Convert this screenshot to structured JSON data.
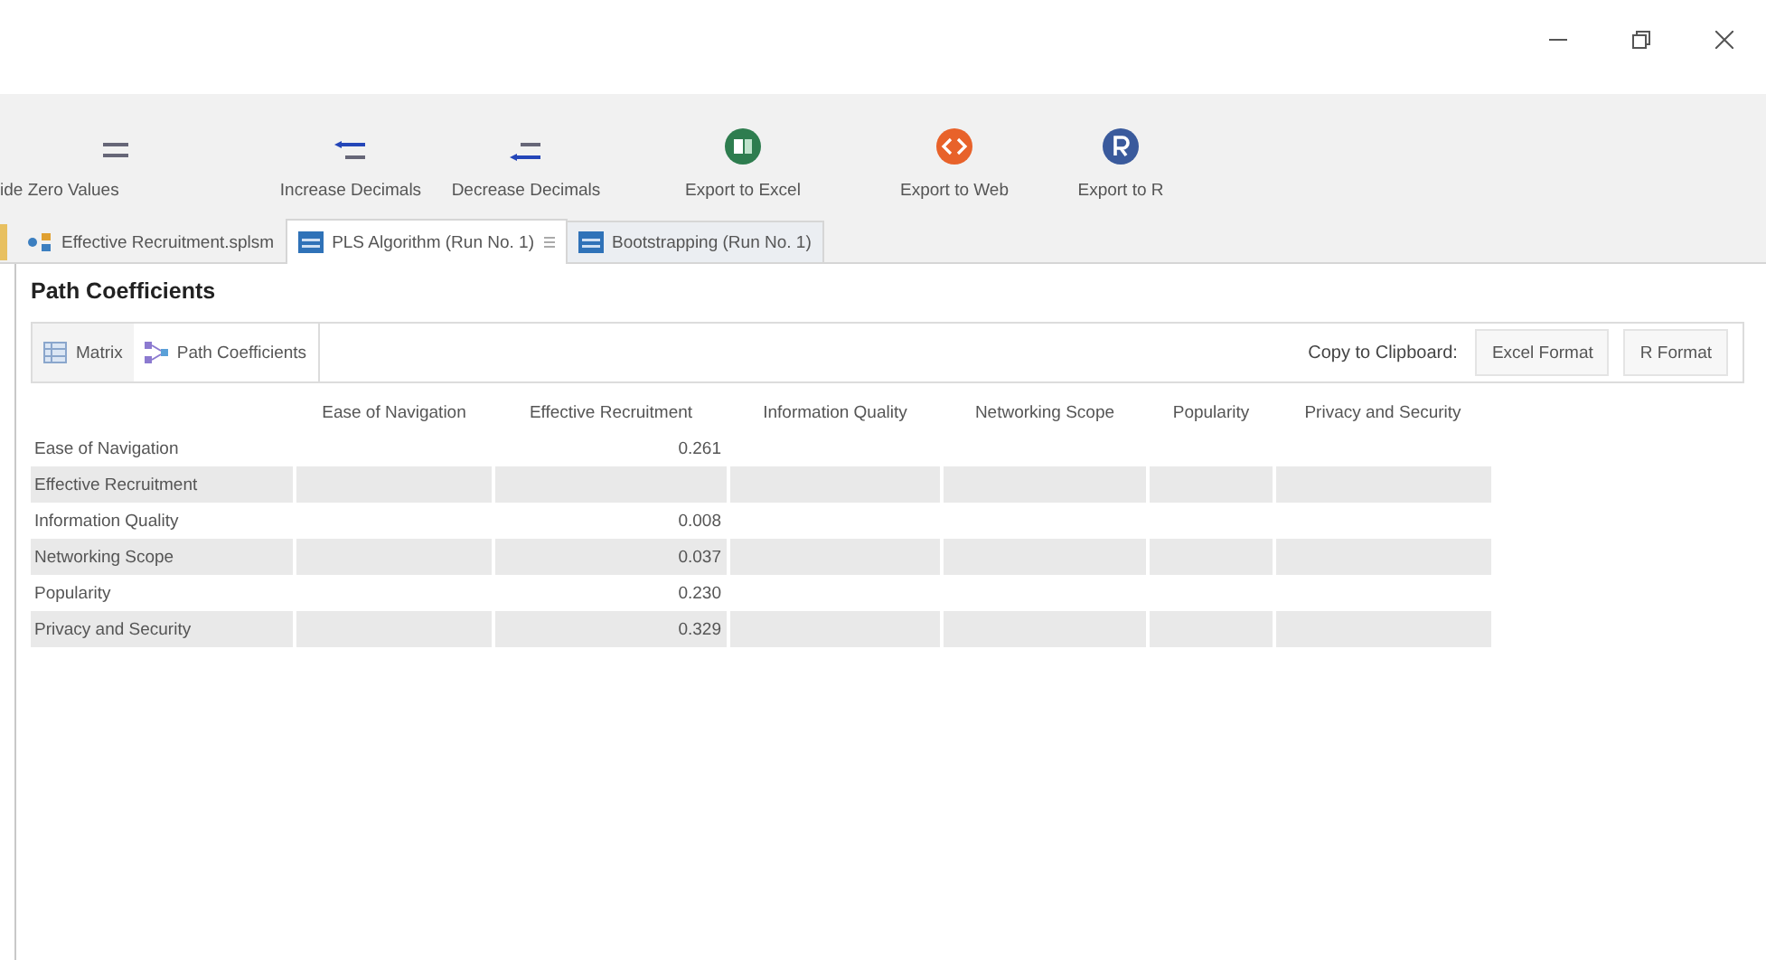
{
  "toolbar": [
    {
      "kind": "zero",
      "label": "ide Zero Values"
    },
    {
      "kind": "increase",
      "label": "Increase Decimals"
    },
    {
      "kind": "decrease",
      "label": "Decrease Decimals"
    },
    {
      "kind": "excel",
      "label": "Export to Excel"
    },
    {
      "kind": "web",
      "label": "Export to Web"
    },
    {
      "kind": "r",
      "label": "Export to R"
    }
  ],
  "tabs": [
    {
      "kind": "model",
      "label": "Effective Recruitment.splsm",
      "selected": false
    },
    {
      "kind": "report",
      "label": "PLS Algorithm (Run No. 1)",
      "selected": true
    },
    {
      "kind": "report",
      "label": "Bootstrapping (Run No. 1)",
      "selected": false
    }
  ],
  "section_title": "Path Coefficients",
  "view_tabs": [
    {
      "kind": "matrix",
      "label": "Matrix",
      "selected": false
    },
    {
      "kind": "path",
      "label": "Path Coefficients",
      "selected": true
    }
  ],
  "clipboard": {
    "label": "Copy to Clipboard:",
    "buttons": [
      "Excel Format",
      "R Format"
    ]
  },
  "table": {
    "columns": [
      "Ease of Navigation",
      "Effective Recruitment",
      "Information Quality",
      "Networking Scope",
      "Popularity",
      "Privacy and Security"
    ],
    "rows": [
      {
        "label": "Ease of Navigation",
        "cells": [
          null,
          "0.261",
          null,
          null,
          null,
          null
        ]
      },
      {
        "label": "Effective Recruitment",
        "cells": [
          null,
          null,
          null,
          null,
          null,
          null
        ]
      },
      {
        "label": "Information Quality",
        "cells": [
          null,
          "0.008",
          null,
          null,
          null,
          null
        ]
      },
      {
        "label": "Networking Scope",
        "cells": [
          null,
          "0.037",
          null,
          null,
          null,
          null
        ]
      },
      {
        "label": "Popularity",
        "cells": [
          null,
          "0.230",
          null,
          null,
          null,
          null
        ]
      },
      {
        "label": "Privacy and Security",
        "cells": [
          null,
          "0.329",
          null,
          null,
          null,
          null
        ]
      }
    ]
  }
}
